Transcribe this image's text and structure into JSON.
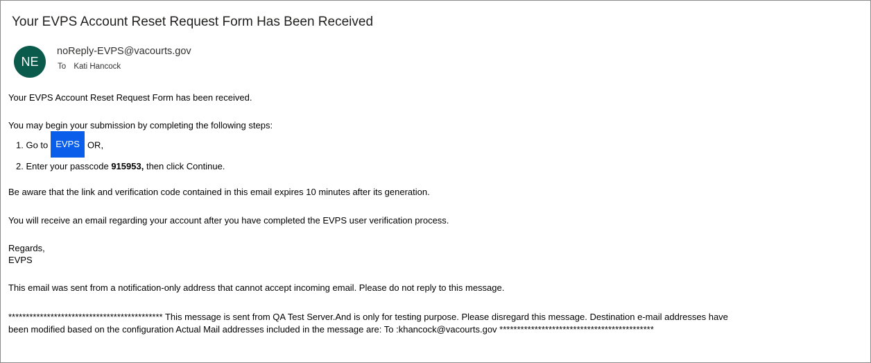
{
  "email": {
    "subject": "Your EVPS Account Reset Request Form Has Been Received",
    "avatar_initials": "NE",
    "avatar_color": "#0b5b4c",
    "sender": "noReply-EVPS@vacourts.gov",
    "to_label": "To",
    "recipient": "Kati Hancock"
  },
  "body": {
    "line_received": "Your EVPS Account Reset Request Form has been received.",
    "line_begin": "You may begin your submission by completing the following steps:",
    "step1_prefix": "1. Go to",
    "evps_link": "EVPS",
    "step1_suffix": "OR,",
    "step2_prefix": "2. Enter your passcode",
    "passcode": "915953,",
    "step2_suffix": "then click Continue.",
    "line_aware": "Be aware that the link and verification code contained in this email expires 10 minutes after its generation.",
    "line_receive": "You will receive an email regarding your account after you have completed the EVPS user verification process.",
    "regards": "Regards,",
    "signature": "EVPS",
    "line_notice": "This email was sent from a notification-only address that cannot accept incoming email. Please do not reply to this message.",
    "qa_line1": "******************************************** This message is sent from QA Test Server.And is only for testing purpose. Please disregard this message. Destination e-mail addresses have",
    "qa_line2": "been modified based on the configuration Actual Mail addresses included in the message are: To :khancock@vacourts.gov ********************************************"
  },
  "colors": {
    "link_button": "#0a5eea"
  }
}
